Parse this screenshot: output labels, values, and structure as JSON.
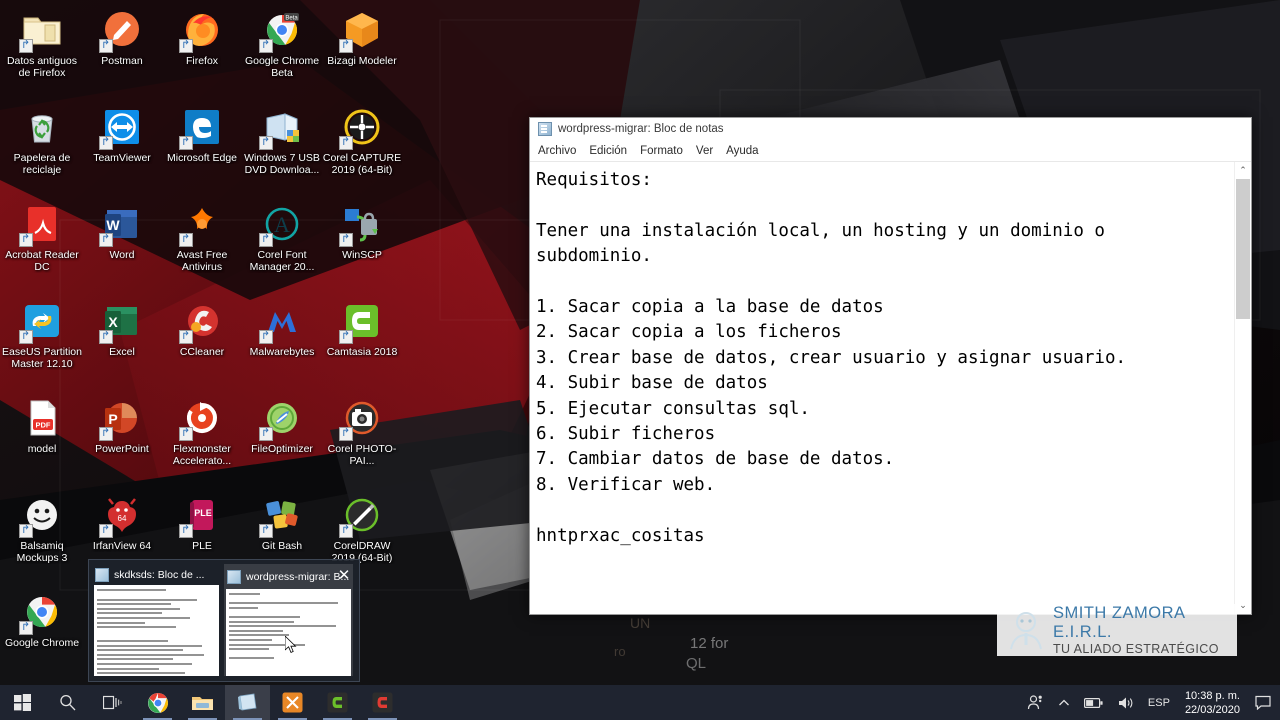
{
  "desktop": {
    "icons": [
      {
        "label": "Datos antiguos de Firefox",
        "icon": "folder-icon",
        "shortcut": true
      },
      {
        "label": "Postman",
        "icon": "postman-icon",
        "shortcut": true
      },
      {
        "label": "Firefox",
        "icon": "firefox-icon",
        "shortcut": true
      },
      {
        "label": "Google Chrome Beta",
        "icon": "chrome-beta-icon",
        "shortcut": true
      },
      {
        "label": "Bizagi Modeler",
        "icon": "bizagi-icon",
        "shortcut": true
      },
      {
        "label": "Papelera de reciclaje",
        "icon": "recycle-bin-icon",
        "shortcut": false
      },
      {
        "label": "TeamViewer",
        "icon": "teamviewer-icon",
        "shortcut": true
      },
      {
        "label": "Microsoft Edge",
        "icon": "edge-icon",
        "shortcut": true
      },
      {
        "label": "Windows 7 USB DVD Downloa...",
        "icon": "win7-usb-dvd-icon",
        "shortcut": true
      },
      {
        "label": "Corel CAPTURE 2019 (64-Bit)",
        "icon": "corel-capture-icon",
        "shortcut": true
      },
      {
        "label": "Acrobat Reader DC",
        "icon": "acrobat-reader-icon",
        "shortcut": true
      },
      {
        "label": "Word",
        "icon": "word-icon",
        "shortcut": true
      },
      {
        "label": "Avast Free Antivirus",
        "icon": "avast-icon",
        "shortcut": true
      },
      {
        "label": "Corel Font Manager 20...",
        "icon": "corel-font-manager-icon",
        "shortcut": true
      },
      {
        "label": "WinSCP",
        "icon": "winscp-icon",
        "shortcut": true
      },
      {
        "label": "EaseUS Partition Master 12.10",
        "icon": "easeus-icon",
        "shortcut": true
      },
      {
        "label": "Excel",
        "icon": "excel-icon",
        "shortcut": true
      },
      {
        "label": "CCleaner",
        "icon": "ccleaner-icon",
        "shortcut": true
      },
      {
        "label": "Malwarebytes",
        "icon": "malwarebytes-icon",
        "shortcut": true
      },
      {
        "label": "Camtasia 2018",
        "icon": "camtasia-icon",
        "shortcut": true
      },
      {
        "label": "model",
        "icon": "pdf-file-icon",
        "shortcut": false
      },
      {
        "label": "PowerPoint",
        "icon": "powerpoint-icon",
        "shortcut": true
      },
      {
        "label": "Flexmonster Accelerato...",
        "icon": "flexmonster-icon",
        "shortcut": true
      },
      {
        "label": "FileOptimizer",
        "icon": "fileoptimizer-icon",
        "shortcut": true
      },
      {
        "label": "Corel PHOTO-PAI...",
        "icon": "corel-photopaint-icon",
        "shortcut": true
      },
      {
        "label": "Balsamiq Mockups 3",
        "icon": "balsamiq-icon",
        "shortcut": true
      },
      {
        "label": "IrfanView 64",
        "icon": "irfanview-icon",
        "shortcut": true
      },
      {
        "label": "PLE",
        "icon": "ple-icon",
        "shortcut": true
      },
      {
        "label": "Git Bash",
        "icon": "git-bash-icon",
        "shortcut": true
      },
      {
        "label": "CorelDRAW 2019 (64-Bit)",
        "icon": "coreldraw-icon",
        "shortcut": true
      },
      {
        "label": "Google Chrome",
        "icon": "chrome-icon",
        "shortcut": true
      }
    ]
  },
  "notepad": {
    "title": "wordpress-migrar: Bloc de notas",
    "menu": [
      "Archivo",
      "Edición",
      "Formato",
      "Ver",
      "Ayuda"
    ],
    "content": "Requisitos:\n\nTener una instalación local, un hosting y un dominio o\nsubdominio.\n\n1. Sacar copia a la base de datos\n2. Sacar copia a los ficheros\n3. Crear base de datos, crear usuario y asignar usuario.\n4. Subir base de datos\n5. Ejecutar consultas sql.\n6. Subir ficheros\n7. Cambiar datos de base de datos.\n8. Verificar web.\n\nhntprxac_cositas",
    "scrollbar": {
      "up_arrow": "⌃",
      "down_arrow": "⌄"
    }
  },
  "thumbnail_preview": {
    "items": [
      {
        "title": "skdksds: Bloc de ...",
        "active": false
      },
      {
        "title": "wordpress-migrar: B...",
        "active": true
      }
    ],
    "close_label": "✕"
  },
  "watermark": {
    "line1": "SMITH ZAMORA E.I.R.L.",
    "line2": "TU ALIADO ESTRATÉGICO"
  },
  "taskbar": {
    "start": "start-icon",
    "pinned": [
      {
        "name": "search-icon",
        "label": "Buscar"
      },
      {
        "name": "task-view-icon",
        "label": "Vista de tareas"
      }
    ],
    "apps": [
      {
        "name": "chrome-taskbar-icon",
        "label": "Google Chrome",
        "active": false,
        "running": true
      },
      {
        "name": "file-explorer-taskbar-icon",
        "label": "Explorador de archivos",
        "active": false,
        "running": true
      },
      {
        "name": "notepad-taskbar-icon",
        "label": "Bloc de notas",
        "active": true,
        "running": true
      },
      {
        "name": "bizagi-taskbar-icon",
        "label": "Bizagi Modeler",
        "active": false,
        "running": true
      },
      {
        "name": "camtasia-taskbar-icon",
        "label": "Camtasia 2018",
        "active": false,
        "running": true
      },
      {
        "name": "coreldraw-taskbar-icon",
        "label": "CorelDRAW",
        "active": false,
        "running": true
      }
    ],
    "tray": {
      "people": "people-icon",
      "chevron": "chevron-up-icon",
      "battery": "battery-icon",
      "volume": "speaker-icon",
      "language": "ESP",
      "time": "10:38 p. m.",
      "date": "22/03/2020",
      "action_center": "action-center-icon"
    }
  }
}
